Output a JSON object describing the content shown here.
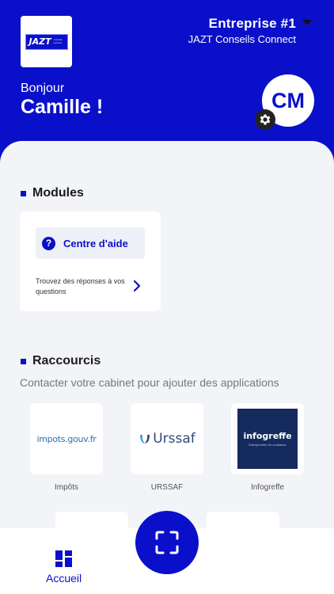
{
  "header": {
    "logo_text": "JAZT",
    "logo_sub": "conseils connect",
    "company": "Entreprise #1",
    "company_sub": "JAZT Conseils Connect",
    "greeting": "Bonjour",
    "username": "Camille !",
    "avatar_initials": "CM"
  },
  "modules": {
    "title": "Modules",
    "items": [
      {
        "label": "Centre d'aide",
        "icon": "question-circle-icon",
        "description": "Trouvez des réponses à vos questions"
      }
    ]
  },
  "shortcuts": {
    "title": "Raccourcis",
    "hint": "Contacter votre cabinet pour ajouter des applications",
    "items": [
      {
        "label": "Impôts",
        "logo_text": "impots.gouv.fr"
      },
      {
        "label": "URSSAF",
        "logo_text": "Urssaf"
      },
      {
        "label": "Infogreffe",
        "logo_text": "infogreffe",
        "logo_sub": "Entreprendre en confiance"
      }
    ]
  },
  "nav": {
    "home_label": "Accueil"
  },
  "colors": {
    "brand": "#0a10c9",
    "background": "#f3f4f8"
  }
}
